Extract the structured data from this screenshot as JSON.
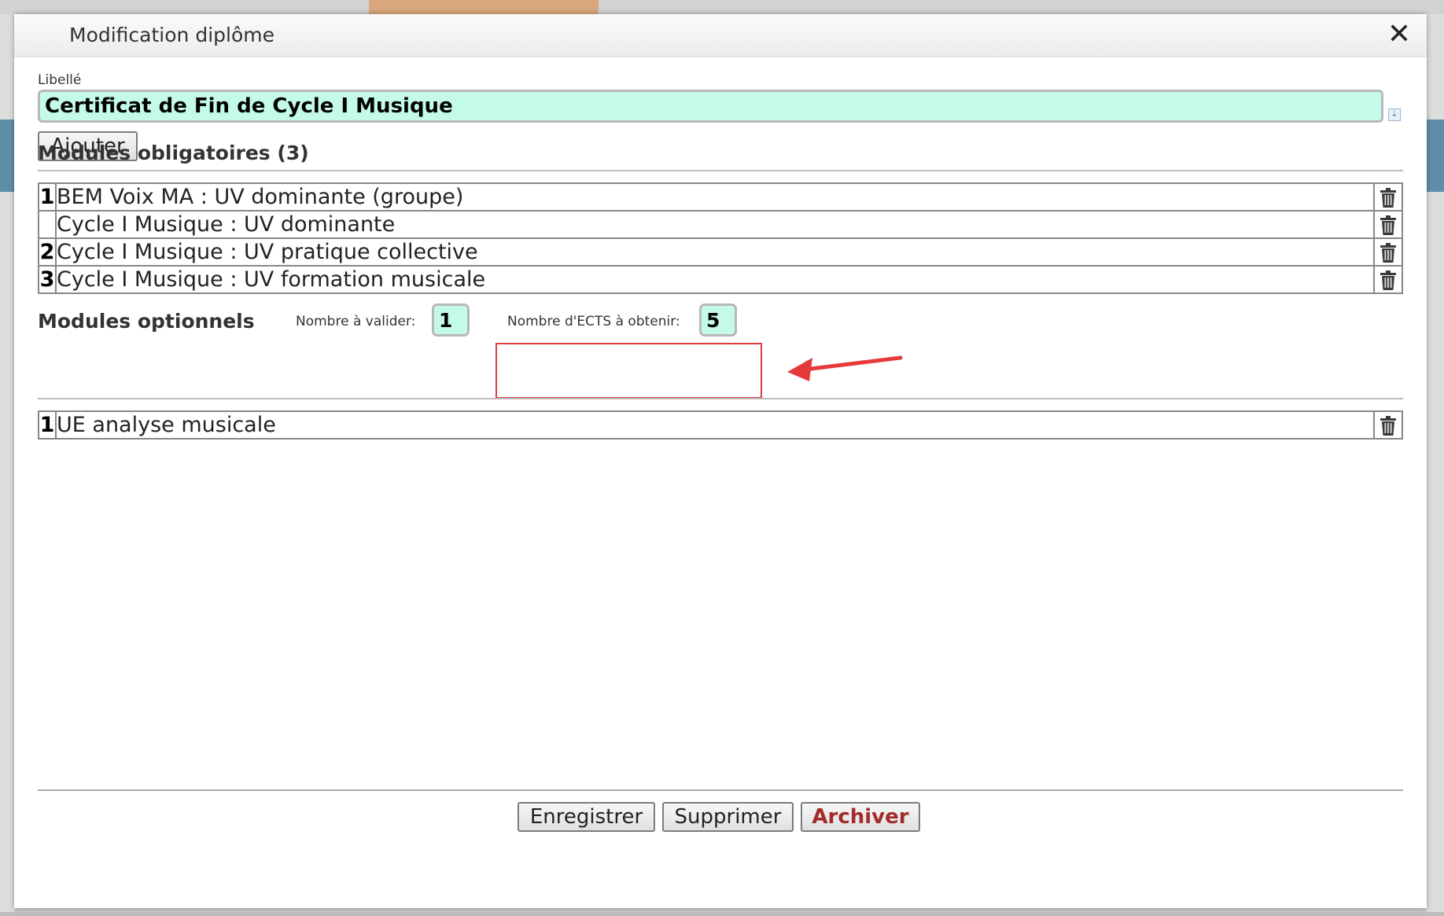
{
  "dialog": {
    "title": "Modification diplôme",
    "close_symbol": "✕"
  },
  "libelle": {
    "label": "Libellé",
    "value": "Certificat de Fin de Cycle I Musique"
  },
  "add_button": "Ajouter",
  "mandatory": {
    "title": "Modules obligatoires (3)",
    "rows": [
      {
        "num": "1",
        "name": "BEM Voix MA : UV dominante (groupe)"
      },
      {
        "num": "",
        "name": "Cycle I Musique : UV dominante"
      },
      {
        "num": "2",
        "name": "Cycle I Musique : UV pratique collective"
      },
      {
        "num": "3",
        "name": "Cycle I Musique : UV formation musicale"
      }
    ]
  },
  "optional": {
    "title": "Modules optionnels",
    "count_label": "Nombre à valider:",
    "count_value": "1",
    "ects_label": "Nombre d'ECTS à obtenir:",
    "ects_value": "5",
    "rows": [
      {
        "num": "1",
        "name": "UE analyse musicale"
      }
    ]
  },
  "footer": {
    "save": "Enregistrer",
    "delete": "Supprimer",
    "archive": "Archiver"
  },
  "icons": {
    "row_action": "trash-icon",
    "close": "close-icon",
    "expand": "expand-icon"
  },
  "colors": {
    "input_bg": "#c4faea",
    "highlight": "#e03c3c",
    "archive_text": "#a32b2b"
  }
}
